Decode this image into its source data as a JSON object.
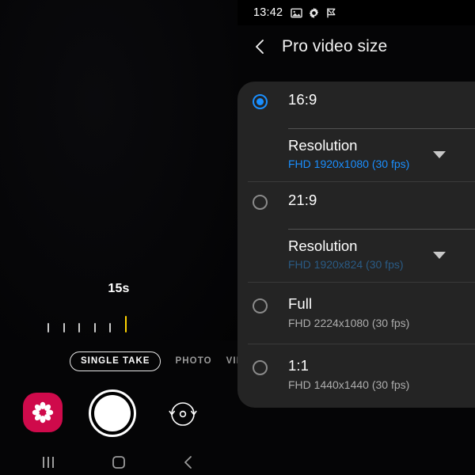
{
  "status_bar": {
    "time": "13:42",
    "icons": [
      "image-icon",
      "gear-icon",
      "flag-icon"
    ]
  },
  "header": {
    "back_icon": "chevron-left-icon",
    "title": "Pro video size"
  },
  "options": [
    {
      "id": "16-9",
      "title": "16:9",
      "selected": true,
      "resolution": {
        "label": "Resolution",
        "value": "FHD 1920x1080 (30 fps)",
        "active": true,
        "caret_icon": "chevron-down-icon"
      }
    },
    {
      "id": "21-9",
      "title": "21:9",
      "selected": false,
      "resolution": {
        "label": "Resolution",
        "value": "FHD 1920x824 (30 fps)",
        "active": false,
        "caret_icon": "chevron-down-icon"
      }
    },
    {
      "id": "full",
      "title": "Full",
      "selected": false,
      "subtitle": "FHD 2224x1080 (30 fps)"
    },
    {
      "id": "1-1",
      "title": "1:1",
      "selected": false,
      "subtitle": "FHD 1440x1440 (30 fps)"
    }
  ],
  "camera": {
    "timer": "15s",
    "ticks": {
      "count": 6,
      "active_index": 5
    },
    "modes": [
      {
        "label": "SINGLE TAKE",
        "selected": true
      },
      {
        "label": "PHOTO",
        "selected": false
      },
      {
        "label": "VIDEO",
        "selected": false
      }
    ],
    "gallery_icon": "flower-gallery-icon",
    "shutter_icon": "shutter-button-icon",
    "flip_icon": "camera-flip-icon"
  },
  "nav_bar": {
    "recents_icon": "recents-icon",
    "home_icon": "home-icon",
    "back_icon": "back-icon"
  },
  "colors": {
    "accent_blue": "#1a8fff",
    "accent_blue_dim": "#2a5b85",
    "gallery_pink": "#cf0a4b",
    "tick_yellow": "#ffd400",
    "panel_bg": "#242424"
  }
}
